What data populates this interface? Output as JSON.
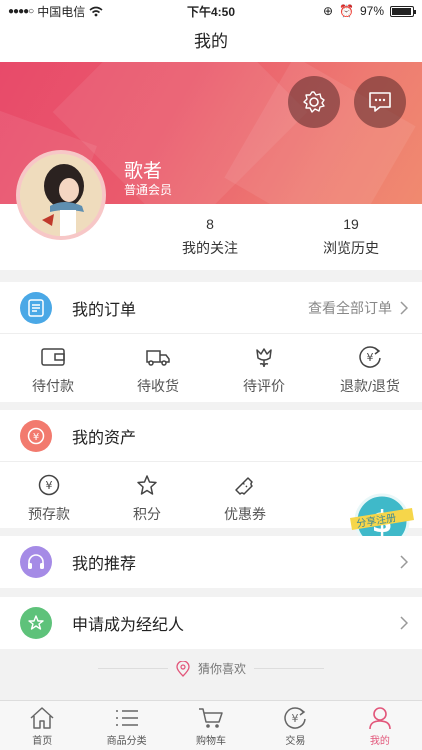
{
  "status_bar": {
    "carrier": "中国电信",
    "time": "下午4:50",
    "battery": "97%",
    "battery_level": 0.97
  },
  "nav": {
    "title": "我的"
  },
  "profile": {
    "name": "歌者",
    "level": "普通会员"
  },
  "stats": [
    {
      "value": "8",
      "label": "我的关注"
    },
    {
      "value": "19",
      "label": "浏览历史"
    }
  ],
  "orders": {
    "title": "我的订单",
    "view_all": "查看全部订单",
    "items": [
      {
        "label": "待付款",
        "icon": "wallet-icon"
      },
      {
        "label": "待收货",
        "icon": "truck-icon"
      },
      {
        "label": "待评价",
        "icon": "flower-icon"
      },
      {
        "label": "退款/退货",
        "icon": "refund-icon"
      }
    ]
  },
  "assets": {
    "title": "我的资产",
    "items": [
      {
        "label": "预存款",
        "icon": "deposit-icon"
      },
      {
        "label": "积分",
        "icon": "star-icon"
      },
      {
        "label": "优惠券",
        "icon": "coupon-icon"
      }
    ]
  },
  "recommend": {
    "title": "我的推荐"
  },
  "agent": {
    "title": "申请成为经纪人"
  },
  "guess": {
    "label": "猜你喜欢"
  },
  "share_badge": {
    "label": "分享注册"
  },
  "tabs": [
    {
      "label": "首页",
      "icon": "home-icon"
    },
    {
      "label": "商品分类",
      "icon": "list-icon"
    },
    {
      "label": "购物车",
      "icon": "cart-icon"
    },
    {
      "label": "交易",
      "icon": "trade-icon"
    },
    {
      "label": "我的",
      "icon": "person-icon",
      "active": true
    }
  ],
  "colors": {
    "accent": "#e2567a",
    "hero_start": "#e84a6a",
    "hero_end": "#f08a6f"
  }
}
